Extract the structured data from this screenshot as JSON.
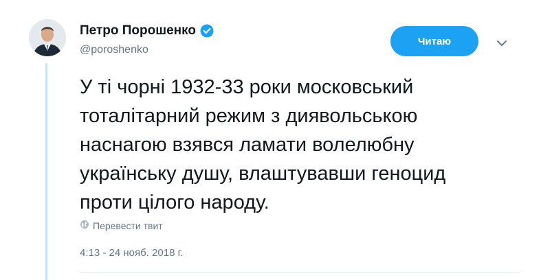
{
  "author": {
    "name": "Петро Порошенко",
    "handle": "@poroshenko",
    "verified": true,
    "avatar_icon": "avatar-photo"
  },
  "follow_button": {
    "label": "Читаю",
    "color": "#1da1f2"
  },
  "menu": {
    "icon": "chevron-down-icon"
  },
  "tweet": {
    "text": "У ті чорні 1932-33 роки московський\nтоталітарний режим з диявольською\nнаснагою взявся ламати волелюбну\nукраїнську душу, влаштувавши геноцид\nпроти цілого народу."
  },
  "translate": {
    "label": "Перевести твит",
    "icon": "globe-icon"
  },
  "timestamp": "4:13 - 24 нояб. 2018 г.",
  "colors": {
    "accent": "#1da1f2",
    "thread_line": "#c4e4fb",
    "text": "#14171a",
    "muted": "#657786"
  }
}
